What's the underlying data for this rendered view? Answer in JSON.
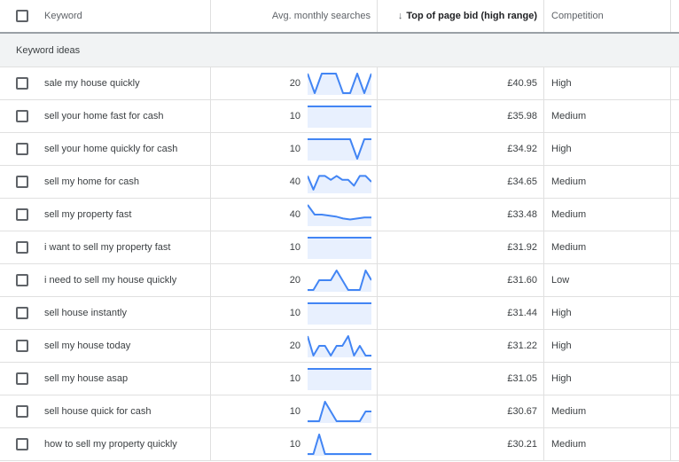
{
  "header": {
    "keyword": "Keyword",
    "avg_monthly_searches": "Avg. monthly searches",
    "top_of_page_bid_high": "Top of page bid (high range)",
    "competition": "Competition",
    "sort_icon": "arrow-down-icon"
  },
  "group_label": "Keyword ideas",
  "colors": {
    "sparkline": "#4285f4",
    "sparkline_fill": "#e8f0fe",
    "group_bg": "#f1f3f4"
  },
  "rows": [
    {
      "keyword": "sale my house quickly",
      "avg": "20",
      "bid": "£40.95",
      "competition": "High",
      "trend": [
        1,
        0,
        1,
        1,
        1,
        0,
        0,
        1,
        0,
        1
      ]
    },
    {
      "keyword": "sell your home fast for cash",
      "avg": "10",
      "bid": "£35.98",
      "competition": "Medium",
      "trend": [
        1,
        1,
        1,
        1,
        1,
        1,
        1,
        1,
        1,
        1
      ]
    },
    {
      "keyword": "sell your home quickly for cash",
      "avg": "10",
      "bid": "£34.92",
      "competition": "High",
      "trend": [
        1,
        1,
        1,
        1,
        1,
        1,
        1,
        0,
        1,
        1
      ]
    },
    {
      "keyword": "sell my home for cash",
      "avg": "40",
      "bid": "£34.65",
      "competition": "Medium",
      "trend": [
        0.8,
        0.1,
        0.8,
        0.8,
        0.6,
        0.8,
        0.6,
        0.6,
        0.3,
        0.8,
        0.8,
        0.5
      ]
    },
    {
      "keyword": "sell my property fast",
      "avg": "40",
      "bid": "£33.48",
      "competition": "Medium",
      "trend": [
        1,
        0.5,
        0.5,
        0.45,
        0.4,
        0.3,
        0.25,
        0.3,
        0.35,
        0.35
      ]
    },
    {
      "keyword": "i want to sell my property fast",
      "avg": "10",
      "bid": "£31.92",
      "competition": "Medium",
      "trend": [
        1,
        1,
        1,
        1,
        1,
        1,
        1,
        1,
        1,
        1
      ]
    },
    {
      "keyword": "i need to sell my house quickly",
      "avg": "20",
      "bid": "£31.60",
      "competition": "Low",
      "trend": [
        0,
        0,
        0.5,
        0.5,
        0.5,
        1,
        0.5,
        0,
        0,
        0,
        1,
        0.5
      ]
    },
    {
      "keyword": "sell house instantly",
      "avg": "10",
      "bid": "£31.44",
      "competition": "High",
      "trend": [
        1,
        1,
        1,
        1,
        1,
        1,
        1,
        1,
        1,
        1
      ]
    },
    {
      "keyword": "sell my house today",
      "avg": "20",
      "bid": "£31.22",
      "competition": "High",
      "trend": [
        1,
        0,
        0.5,
        0.5,
        0,
        0.5,
        0.5,
        1,
        0,
        0.5,
        0,
        0
      ]
    },
    {
      "keyword": "sell my house asap",
      "avg": "10",
      "bid": "£31.05",
      "competition": "High",
      "trend": [
        1,
        1,
        1,
        1,
        1,
        1,
        1,
        1,
        1,
        1
      ]
    },
    {
      "keyword": "sell house quick for cash",
      "avg": "10",
      "bid": "£30.67",
      "competition": "Medium",
      "trend": [
        0,
        0,
        0,
        1,
        0.5,
        0,
        0,
        0,
        0,
        0,
        0.5,
        0.5
      ]
    },
    {
      "keyword": "how to sell my property quickly",
      "avg": "10",
      "bid": "£30.21",
      "competition": "Medium",
      "trend": [
        0,
        0,
        1,
        0,
        0,
        0,
        0,
        0,
        0,
        0,
        0,
        0
      ]
    }
  ]
}
